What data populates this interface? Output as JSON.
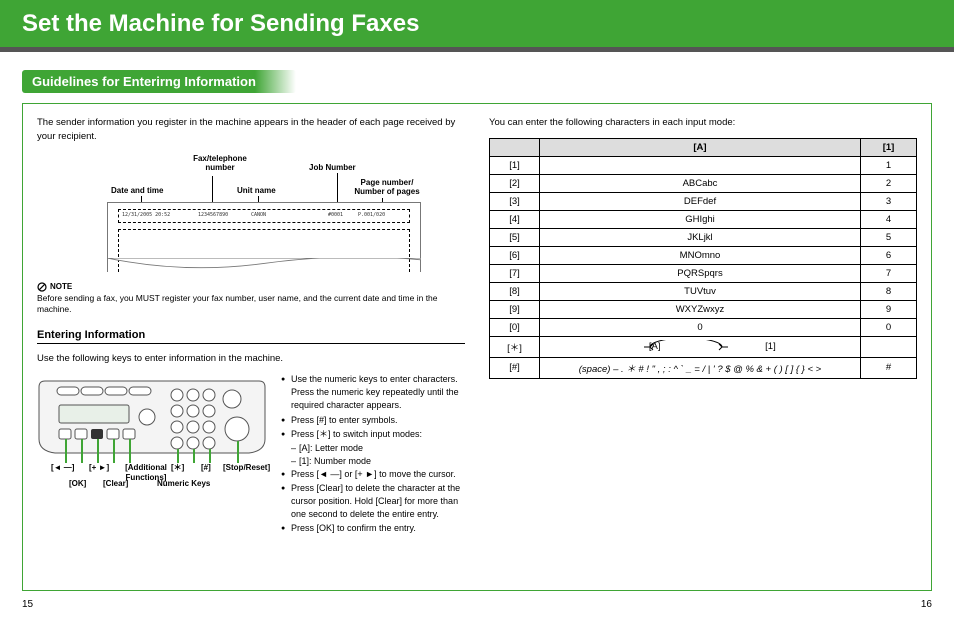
{
  "page": {
    "title": "Set the Machine for Sending Faxes",
    "section_header": "Guidelines for Enterirng Information",
    "left_page_no": "15",
    "right_page_no": "16"
  },
  "left": {
    "intro": "The sender information you register in the machine appears in the header of each page received by your recipient.",
    "diagram_labels": {
      "date_time": "Date and time",
      "fax_tel": "Fax/telephone number",
      "unit_name": "Unit name",
      "job_no": "Job Number",
      "page_no": "Page number/ Number of pages"
    },
    "sample_header": {
      "date": "12/31/2005  20:52",
      "fax": "1234567890",
      "unit": "CANON",
      "job": "#0001",
      "pages": "P.001/020"
    },
    "note_label": "NOTE",
    "note_text": "Before sending a fax, you MUST register your fax number, user name, and the current date and time in the machine.",
    "sub_header": "Entering Information",
    "sub_intro": "Use the following keys to enter information in the machine.",
    "key_labels": {
      "left_arrow": "[◄ —]",
      "right_arrow": "[+ ►]",
      "ok": "[OK]",
      "additional": "[Additional Functions]",
      "clear": "[Clear]",
      "star": "[＊]",
      "hash": "[#]",
      "numeric": "Numeric Keys",
      "stop": "[Stop/Reset]"
    },
    "bullets": {
      "b1": "Use the numeric keys to enter characters. Press the numeric key repeatedly until the required character appears.",
      "b2": "Press [#] to enter symbols.",
      "b3": "Press [＊] to switch input modes:",
      "b3a": "[A]: Letter mode",
      "b3b": "[1]: Number mode",
      "b4": "Press [◄ —] or [+ ►] to move the cursor.",
      "b5": "Press [Clear] to delete the character at the cursor position. Hold [Clear] for more than one second to delete the entire entry.",
      "b6": "Press [OK] to confirm the entry."
    }
  },
  "right": {
    "intro": "You can enter the following characters in each input mode:",
    "th_a": "[A]",
    "th_1": "[1]",
    "rows": [
      {
        "k": "[1]",
        "a": "",
        "n": "1"
      },
      {
        "k": "[2]",
        "a": "ABCabc",
        "n": "2"
      },
      {
        "k": "[3]",
        "a": "DEFdef",
        "n": "3"
      },
      {
        "k": "[4]",
        "a": "GHIghi",
        "n": "4"
      },
      {
        "k": "[5]",
        "a": "JKLjkl",
        "n": "5"
      },
      {
        "k": "[6]",
        "a": "MNOmno",
        "n": "6"
      },
      {
        "k": "[7]",
        "a": "PQRSpqrs",
        "n": "7"
      },
      {
        "k": "[8]",
        "a": "TUVtuv",
        "n": "8"
      },
      {
        "k": "[9]",
        "a": "WXYZwxyz",
        "n": "9"
      },
      {
        "k": "[0]",
        "a": "0",
        "n": "0"
      }
    ],
    "star_key": "[＊]",
    "star_a_left": "[A]",
    "star_a_right": "[1]",
    "hash_key": "[#]",
    "hash_a": "(space) – .  ＊ # ! \" , ; : ^ ` _ = / | ' ? $ @ % & + ( ) [ ] { } < >",
    "hash_n": "#"
  }
}
